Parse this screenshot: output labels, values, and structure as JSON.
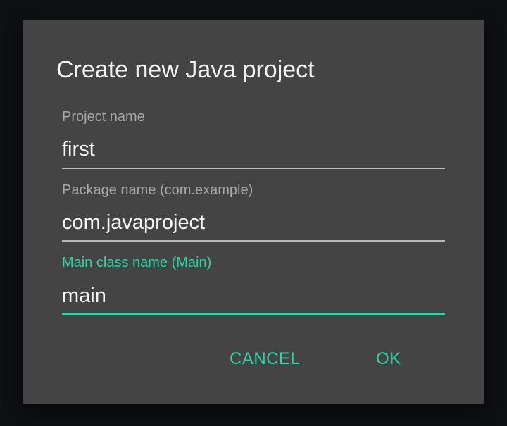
{
  "dialog": {
    "title": "Create new Java project",
    "fields": {
      "project_name": {
        "label": "Project name",
        "value": "first"
      },
      "package_name": {
        "label": "Package name (com.example)",
        "value": "com.javaproject"
      },
      "main_class_name": {
        "label": "Main class name (Main)",
        "value": "main"
      }
    },
    "buttons": {
      "cancel_label": "CANCEL",
      "ok_label": "OK"
    },
    "colors": {
      "accent": "#2ed3a6",
      "dialog_background": "#444444",
      "backdrop": "#0f1013"
    }
  }
}
